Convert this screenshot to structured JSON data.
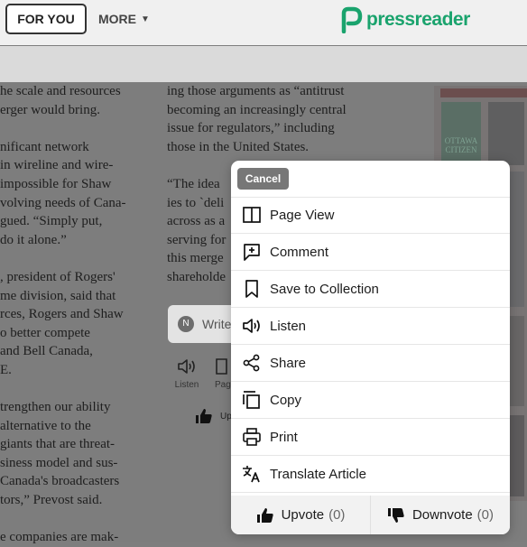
{
  "nav": {
    "for_you": "FOR YOU",
    "more": "MORE",
    "logo_text": "pressreader"
  },
  "article": {
    "col1": [
      "he scale and resources",
      "erger would bring.",
      "",
      "nificant network",
      "in wireline and wire-",
      "impossible for Shaw",
      "volving needs of Cana-",
      "gued. “Simply put,",
      "do it alone.”",
      "",
      ", president of Rogers'",
      "me division, said that",
      "rces, Rogers and Shaw",
      "o better compete",
      " and Bell Canada,",
      "E.",
      "",
      "trengthen our ability",
      " alternative to the",
      "giants that are threat-",
      "siness model and sus-",
      " Canada's broadcasters",
      "tors,” Prevost said.",
      "",
      "e companies are mak-"
    ],
    "col2": [
      "ing those arguments as “antitrust",
      "becoming an increasingly central",
      "issue for regulators,” including",
      "those in the United States.",
      "",
      "“The idea",
      "ies to `deli",
      "across as a",
      "serving for",
      "this merge",
      "shareholde"
    ],
    "comment_avatar": "N",
    "comment_placeholder": "Write",
    "listen_label": "Listen",
    "page_label": "Pag",
    "upvote_partial": "Up",
    "paper_masthead": "OTTAWA CITIZEN"
  },
  "sheet": {
    "cancel": "Cancel",
    "items": [
      {
        "label": "Page View",
        "icon": "page-view-icon"
      },
      {
        "label": "Comment",
        "icon": "comment-icon"
      },
      {
        "label": "Save to Collection",
        "icon": "bookmark-icon"
      },
      {
        "label": "Listen",
        "icon": "speaker-icon"
      },
      {
        "label": "Share",
        "icon": "share-icon"
      },
      {
        "label": "Copy",
        "icon": "copy-icon"
      },
      {
        "label": "Print",
        "icon": "printer-icon"
      },
      {
        "label": "Translate Article",
        "icon": "translate-icon"
      }
    ],
    "upvote": {
      "label": "Upvote",
      "count": "(0)"
    },
    "downvote": {
      "label": "Downvote",
      "count": "(0)"
    }
  },
  "colors": {
    "brand": "#1aa36d",
    "overlay_bg": "#7d7d7d",
    "sheet_bg": "#ffffff",
    "cancel_bg": "#777777"
  }
}
